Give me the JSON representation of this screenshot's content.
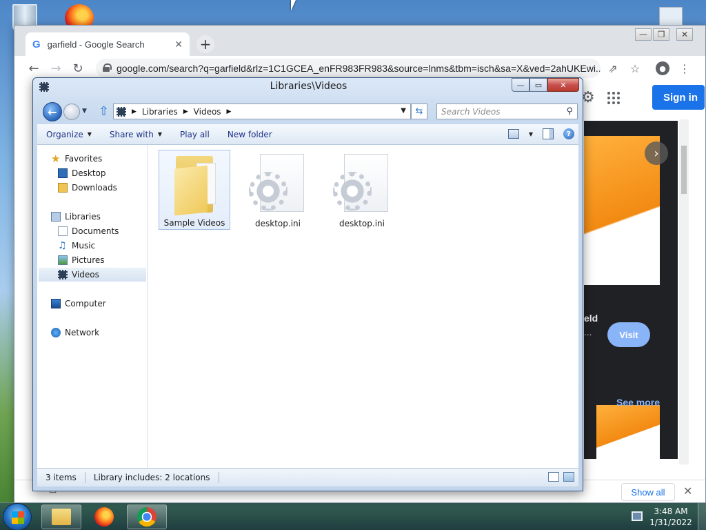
{
  "chrome": {
    "tab_title": "garfield - Google Search",
    "url": "google.com/search?q=garfield&rlz=1C1GCEA_enFR983FR983&source=lnms&tbm=isch&sa=X&ved=2ahUKEwi...",
    "sign_in": "Sign in",
    "visit": "Visit",
    "see_more": "See more",
    "show_all": "Show all",
    "panel_partial_1": "eld",
    "panel_partial_2": "..."
  },
  "explorer": {
    "title": "Libraries\\Videos",
    "breadcrumb": [
      "Libraries",
      "Videos"
    ],
    "search_placeholder": "Search Videos",
    "commands": {
      "organize": "Organize",
      "share_with": "Share with",
      "play_all": "Play all",
      "new_folder": "New folder"
    },
    "nav": {
      "favorites": "Favorites",
      "desktop": "Desktop",
      "downloads": "Downloads",
      "libraries": "Libraries",
      "documents": "Documents",
      "music": "Music",
      "pictures": "Pictures",
      "videos": "Videos",
      "computer": "Computer",
      "network": "Network"
    },
    "files": [
      {
        "name": "Sample Videos",
        "type": "folder"
      },
      {
        "name": "desktop.ini",
        "type": "ini"
      },
      {
        "name": "desktop.ini",
        "type": "ini"
      }
    ],
    "status": {
      "items": "3 items",
      "library": "Library includes: 2 locations"
    }
  },
  "taskbar": {
    "time": "3:48 AM",
    "date": "1/31/2022"
  },
  "icons": [
    "recycle-bin-icon",
    "firefox-icon",
    "google-icon",
    "lock-icon",
    "settings-icon",
    "apps-icon",
    "folder-icon",
    "gear-file-icon",
    "chrome-icon",
    "start-icon",
    "network-tray-icon"
  ]
}
